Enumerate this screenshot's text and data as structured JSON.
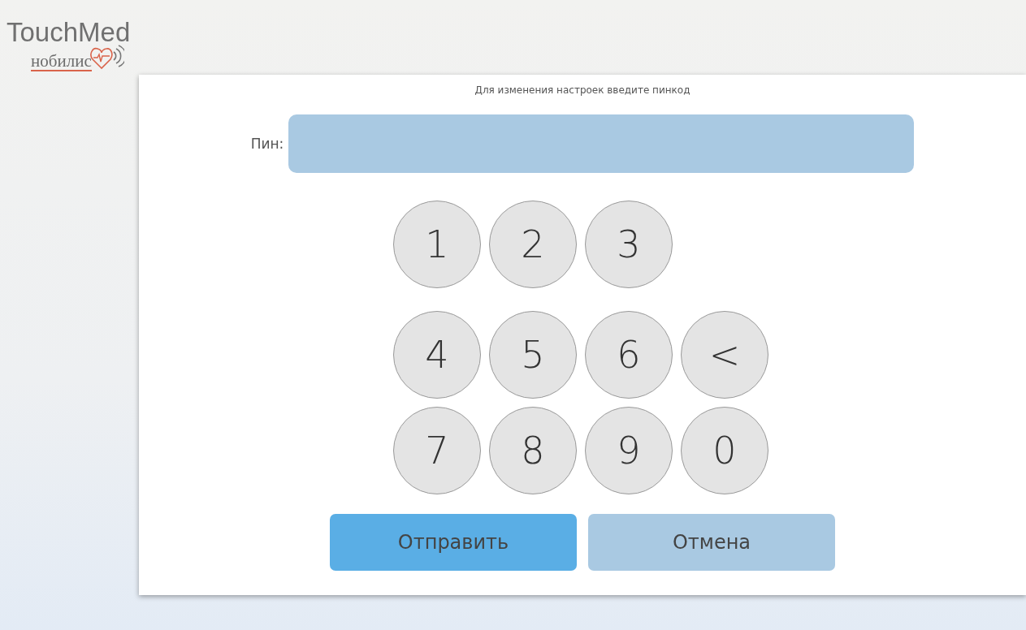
{
  "logo": {
    "title": "TouchMed",
    "subtitle": "нобилис"
  },
  "dialog": {
    "prompt": "Для изменения настроек введите пинкод",
    "pin": {
      "label": "Пин:"
    },
    "key_rows": [
      [
        {
          "label": "1"
        },
        {
          "label": "2"
        },
        {
          "label": "3"
        }
      ],
      [
        {
          "label": "4"
        },
        {
          "label": "5"
        },
        {
          "label": "6"
        },
        {
          "label": "<"
        }
      ],
      [
        {
          "label": "7"
        },
        {
          "label": "8"
        },
        {
          "label": "9"
        },
        {
          "label": "0"
        }
      ]
    ],
    "buttons": [
      {
        "label": "Отправить",
        "kind": "primary"
      },
      {
        "label": "Отмена",
        "kind": "secondary"
      }
    ]
  }
}
